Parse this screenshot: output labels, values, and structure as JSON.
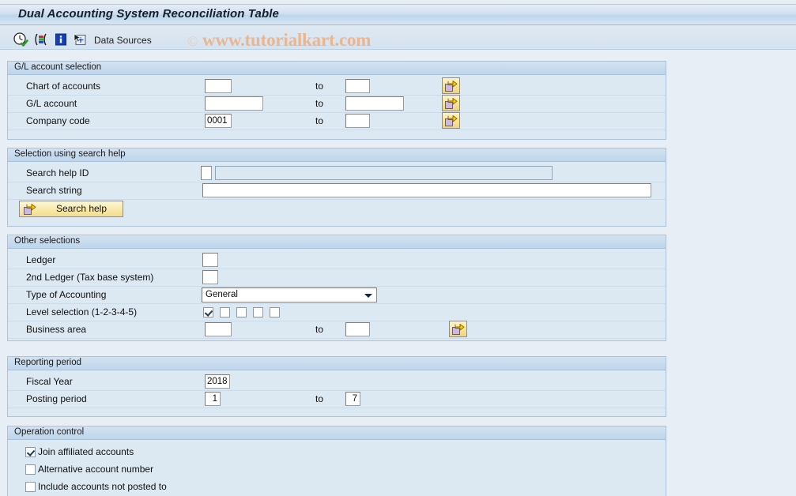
{
  "window": {
    "title": "Dual Accounting System Reconciliation Table"
  },
  "toolbar": {
    "icons": [
      {
        "name": "execute-clock-icon"
      },
      {
        "name": "variant-colorbars-icon"
      },
      {
        "name": "info-icon"
      },
      {
        "name": "select-layout-icon"
      }
    ],
    "data_sources_label": "Data Sources",
    "watermark": "www.tutorialkart.com",
    "watermark_mark": "©"
  },
  "sections": {
    "gl_account_selection": {
      "header": "G/L account selection",
      "rows": [
        {
          "label": "Chart of accounts",
          "value": "",
          "to_label": "to",
          "to_value": ""
        },
        {
          "label": "G/L account",
          "value": "",
          "to_label": "to",
          "to_value": ""
        },
        {
          "label": "Company code",
          "value": "0001",
          "to_label": "to",
          "to_value": ""
        }
      ]
    },
    "search_help": {
      "header": "Selection using search help",
      "id_label": "Search help ID",
      "id_value": "",
      "id_desc_value": "",
      "string_label": "Search string",
      "string_value": "",
      "button_label": "Search help"
    },
    "other_selections": {
      "header": "Other selections",
      "ledger_label": "Ledger",
      "ledger_value": "",
      "ledger2_label": "2nd Ledger (Tax base system)",
      "ledger2_value": "",
      "type_label": "Type of Accounting",
      "type_value": "General",
      "type_options": [
        "General"
      ],
      "level_label": "Level selection (1-2-3-4-5)",
      "level_checked": [
        true,
        false,
        false,
        false,
        false
      ],
      "business_area_label": "Business area",
      "business_area_value": "",
      "business_area_to_label": "to",
      "business_area_to_value": ""
    },
    "reporting_period": {
      "header": "Reporting period",
      "fiscal_year_label": "Fiscal Year",
      "fiscal_year_value": "2018",
      "posting_period_label": "Posting period",
      "posting_period_value": "1",
      "posting_period_to_label": "to",
      "posting_period_to_value": "7"
    },
    "operation_control": {
      "header": "Operation control",
      "options": [
        {
          "label": "Join affiliated accounts",
          "checked": true
        },
        {
          "label": "Alternative account number",
          "checked": false
        },
        {
          "label": "Include accounts not posted to",
          "checked": false
        }
      ]
    }
  },
  "colors": {
    "page_background": "#e8eef5",
    "panel_background": "#dce8f2",
    "panel_border": "#aac3da",
    "header_gradient_top": "#d3e2f1",
    "header_gradient_bottom": "#bfd5ea",
    "accent_yellow": "#f6e29a",
    "watermark": "#e8b792"
  }
}
